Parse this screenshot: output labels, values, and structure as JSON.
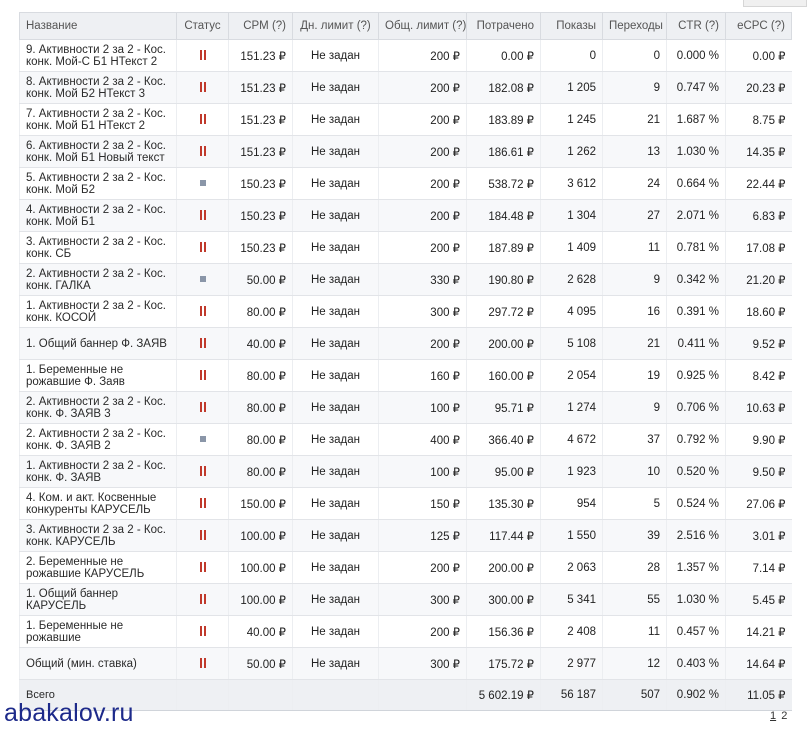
{
  "columns": {
    "name": "Название",
    "status": "Статус",
    "cpm": "CPM (?)",
    "daily_limit": "Дн. лимит (?)",
    "total_limit": "Общ. лимит (?)",
    "spent": "Потрачено",
    "impressions": "Показы",
    "clicks": "Переходы",
    "ctr": "CTR (?)",
    "ecpc": "eCPC (?)"
  },
  "rows": [
    {
      "name": "9. Активности 2 за 2 - Кос. конк. Мой-С Б1 НТекст 2",
      "status": "paused",
      "cpm": "151.23 ₽",
      "daily_limit": "Не задан",
      "total_limit": "200 ₽",
      "spent": "0.00 ₽",
      "impressions": "0",
      "clicks": "0",
      "ctr": "0.000 %",
      "ecpc": "0.00 ₽"
    },
    {
      "name": "8. Активности 2 за 2 - Кос. конк. Мой Б2 НТекст 3",
      "status": "paused",
      "cpm": "151.23 ₽",
      "daily_limit": "Не задан",
      "total_limit": "200 ₽",
      "spent": "182.08 ₽",
      "impressions": "1 205",
      "clicks": "9",
      "ctr": "0.747 %",
      "ecpc": "20.23 ₽"
    },
    {
      "name": "7. Активности 2 за 2 - Кос. конк. Мой Б1 НТекст 2",
      "status": "paused",
      "cpm": "151.23 ₽",
      "daily_limit": "Не задан",
      "total_limit": "200 ₽",
      "spent": "183.89 ₽",
      "impressions": "1 245",
      "clicks": "21",
      "ctr": "1.687 %",
      "ecpc": "8.75 ₽"
    },
    {
      "name": "6. Активности 2 за 2 - Кос. конк. Мой Б1 Новый текст",
      "status": "paused",
      "cpm": "151.23 ₽",
      "daily_limit": "Не задан",
      "total_limit": "200 ₽",
      "spent": "186.61 ₽",
      "impressions": "1 262",
      "clicks": "13",
      "ctr": "1.030 %",
      "ecpc": "14.35 ₽"
    },
    {
      "name": "5. Активности 2 за 2 - Кос. конк. Мой Б2",
      "status": "stopped",
      "cpm": "150.23 ₽",
      "daily_limit": "Не задан",
      "total_limit": "200 ₽",
      "spent": "538.72 ₽",
      "impressions": "3 612",
      "clicks": "24",
      "ctr": "0.664 %",
      "ecpc": "22.44 ₽"
    },
    {
      "name": "4. Активности 2 за 2 - Кос. конк. Мой Б1",
      "status": "paused",
      "cpm": "150.23 ₽",
      "daily_limit": "Не задан",
      "total_limit": "200 ₽",
      "spent": "184.48 ₽",
      "impressions": "1 304",
      "clicks": "27",
      "ctr": "2.071 %",
      "ecpc": "6.83 ₽"
    },
    {
      "name": "3. Активности 2 за 2 - Кос. конк. СБ",
      "status": "paused",
      "cpm": "150.23 ₽",
      "daily_limit": "Не задан",
      "total_limit": "200 ₽",
      "spent": "187.89 ₽",
      "impressions": "1 409",
      "clicks": "11",
      "ctr": "0.781 %",
      "ecpc": "17.08 ₽"
    },
    {
      "name": "2. Активности 2 за 2 - Кос. конк. ГАЛКА",
      "status": "stopped",
      "cpm": "50.00 ₽",
      "daily_limit": "Не задан",
      "total_limit": "330 ₽",
      "spent": "190.80 ₽",
      "impressions": "2 628",
      "clicks": "9",
      "ctr": "0.342 %",
      "ecpc": "21.20 ₽"
    },
    {
      "name": "1. Активности 2 за 2 - Кос. конк. КОСОЙ",
      "status": "paused",
      "cpm": "80.00 ₽",
      "daily_limit": "Не задан",
      "total_limit": "300 ₽",
      "spent": "297.72 ₽",
      "impressions": "4 095",
      "clicks": "16",
      "ctr": "0.391 %",
      "ecpc": "18.60 ₽"
    },
    {
      "name": "1. Общий баннер Ф. ЗАЯВ",
      "status": "paused",
      "cpm": "40.00 ₽",
      "daily_limit": "Не задан",
      "total_limit": "200 ₽",
      "spent": "200.00 ₽",
      "impressions": "5 108",
      "clicks": "21",
      "ctr": "0.411 %",
      "ecpc": "9.52 ₽"
    },
    {
      "name": "1. Беременные не рожавшие Ф. Заяв",
      "status": "paused",
      "cpm": "80.00 ₽",
      "daily_limit": "Не задан",
      "total_limit": "160 ₽",
      "spent": "160.00 ₽",
      "impressions": "2 054",
      "clicks": "19",
      "ctr": "0.925 %",
      "ecpc": "8.42 ₽"
    },
    {
      "name": "2. Активности 2 за 2 - Кос. конк. Ф. ЗАЯВ 3",
      "status": "paused",
      "cpm": "80.00 ₽",
      "daily_limit": "Не задан",
      "total_limit": "100 ₽",
      "spent": "95.71 ₽",
      "impressions": "1 274",
      "clicks": "9",
      "ctr": "0.706 %",
      "ecpc": "10.63 ₽"
    },
    {
      "name": "2. Активности 2 за 2 - Кос. конк. Ф. ЗАЯВ 2",
      "status": "stopped",
      "cpm": "80.00 ₽",
      "daily_limit": "Не задан",
      "total_limit": "400 ₽",
      "spent": "366.40 ₽",
      "impressions": "4 672",
      "clicks": "37",
      "ctr": "0.792 %",
      "ecpc": "9.90 ₽"
    },
    {
      "name": "1. Активности 2 за 2 - Кос. конк. Ф. ЗАЯВ",
      "status": "paused",
      "cpm": "80.00 ₽",
      "daily_limit": "Не задан",
      "total_limit": "100 ₽",
      "spent": "95.00 ₽",
      "impressions": "1 923",
      "clicks": "10",
      "ctr": "0.520 %",
      "ecpc": "9.50 ₽"
    },
    {
      "name": "4. Ком. и акт. Косвенные конкуренты КАРУСЕЛЬ",
      "status": "paused",
      "cpm": "150.00 ₽",
      "daily_limit": "Не задан",
      "total_limit": "150 ₽",
      "spent": "135.30 ₽",
      "impressions": "954",
      "clicks": "5",
      "ctr": "0.524 %",
      "ecpc": "27.06 ₽"
    },
    {
      "name": "3. Активности 2 за 2 - Кос. конк. КАРУСЕЛЬ",
      "status": "paused",
      "cpm": "100.00 ₽",
      "daily_limit": "Не задан",
      "total_limit": "125 ₽",
      "spent": "117.44 ₽",
      "impressions": "1 550",
      "clicks": "39",
      "ctr": "2.516 %",
      "ecpc": "3.01 ₽"
    },
    {
      "name": "2. Беременные не рожавшие КАРУСЕЛЬ",
      "status": "paused",
      "cpm": "100.00 ₽",
      "daily_limit": "Не задан",
      "total_limit": "200 ₽",
      "spent": "200.00 ₽",
      "impressions": "2 063",
      "clicks": "28",
      "ctr": "1.357 %",
      "ecpc": "7.14 ₽"
    },
    {
      "name": "1. Общий баннер КАРУСЕЛЬ",
      "status": "paused",
      "cpm": "100.00 ₽",
      "daily_limit": "Не задан",
      "total_limit": "300 ₽",
      "spent": "300.00 ₽",
      "impressions": "5 341",
      "clicks": "55",
      "ctr": "1.030 %",
      "ecpc": "5.45 ₽"
    },
    {
      "name": "1. Беременные не рожавшие",
      "status": "paused",
      "cpm": "40.00 ₽",
      "daily_limit": "Не задан",
      "total_limit": "200 ₽",
      "spent": "156.36 ₽",
      "impressions": "2 408",
      "clicks": "11",
      "ctr": "0.457 %",
      "ecpc": "14.21 ₽"
    },
    {
      "name": "Общий (мин. ставка)",
      "status": "paused",
      "cpm": "50.00 ₽",
      "daily_limit": "Не задан",
      "total_limit": "300 ₽",
      "spent": "175.72 ₽",
      "impressions": "2 977",
      "clicks": "12",
      "ctr": "0.403 %",
      "ecpc": "14.64 ₽"
    }
  ],
  "totals": {
    "label": "Всего",
    "spent": "5 602.19 ₽",
    "impressions": "56 187",
    "clicks": "507",
    "ctr": "0.902 %",
    "ecpc": "11.05 ₽"
  },
  "pager": {
    "page1": "1",
    "page2": "2"
  },
  "watermark": "abakalov.ru",
  "colors": {
    "pause": "#c0392b",
    "stop": "#8a96a8",
    "header_bg": "#eef0f3",
    "watermark": "#1d2a8a"
  }
}
